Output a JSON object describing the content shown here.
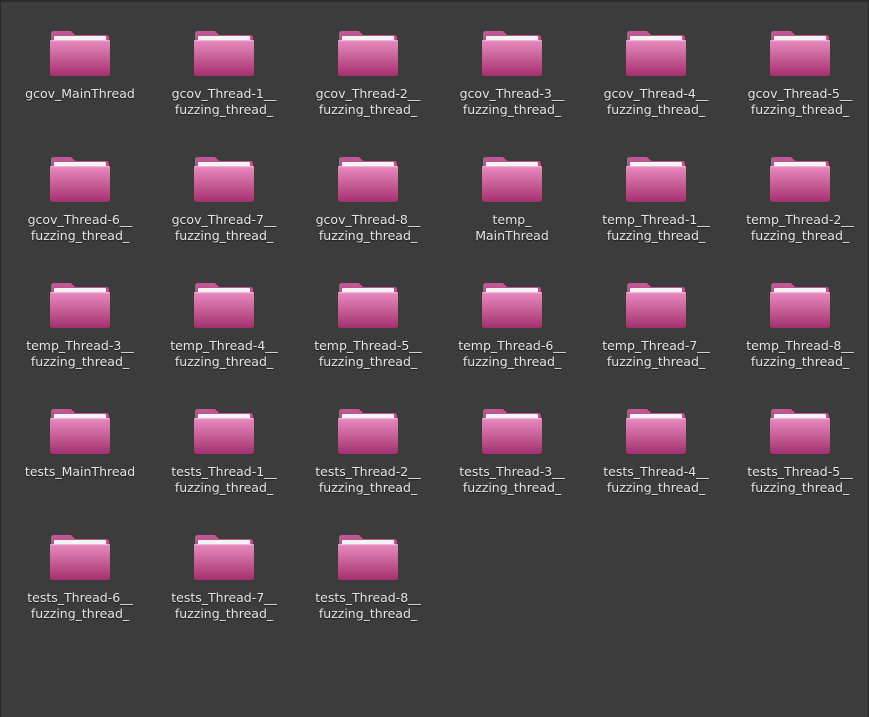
{
  "colors": {
    "background": "#3c3c3c",
    "folder_top": "#e98bc0",
    "folder_bottom": "#a3306e",
    "folder_paper": "#f4f4f4",
    "label_text": "#e6e6e6"
  },
  "icon": "folder-icon",
  "folders": [
    {
      "line1": "gcov_MainThread",
      "line2": ""
    },
    {
      "line1": "gcov_Thread-1__",
      "line2": "fuzzing_thread_"
    },
    {
      "line1": "gcov_Thread-2__",
      "line2": "fuzzing_thread_"
    },
    {
      "line1": "gcov_Thread-3__",
      "line2": "fuzzing_thread_"
    },
    {
      "line1": "gcov_Thread-4__",
      "line2": "fuzzing_thread_"
    },
    {
      "line1": "gcov_Thread-5__",
      "line2": "fuzzing_thread_"
    },
    {
      "line1": "gcov_Thread-6__",
      "line2": "fuzzing_thread_"
    },
    {
      "line1": "gcov_Thread-7__",
      "line2": "fuzzing_thread_"
    },
    {
      "line1": "gcov_Thread-8__",
      "line2": "fuzzing_thread_"
    },
    {
      "line1": "temp_",
      "line2": "MainThread"
    },
    {
      "line1": "temp_Thread-1__",
      "line2": "fuzzing_thread_"
    },
    {
      "line1": "temp_Thread-2__",
      "line2": "fuzzing_thread_"
    },
    {
      "line1": "temp_Thread-3__",
      "line2": "fuzzing_thread_"
    },
    {
      "line1": "temp_Thread-4__",
      "line2": "fuzzing_thread_"
    },
    {
      "line1": "temp_Thread-5__",
      "line2": "fuzzing_thread_"
    },
    {
      "line1": "temp_Thread-6__",
      "line2": "fuzzing_thread_"
    },
    {
      "line1": "temp_Thread-7__",
      "line2": "fuzzing_thread_"
    },
    {
      "line1": "temp_Thread-8__",
      "line2": "fuzzing_thread_"
    },
    {
      "line1": "tests_MainThread",
      "line2": ""
    },
    {
      "line1": "tests_Thread-1__",
      "line2": "fuzzing_thread_"
    },
    {
      "line1": "tests_Thread-2__",
      "line2": "fuzzing_thread_"
    },
    {
      "line1": "tests_Thread-3__",
      "line2": "fuzzing_thread_"
    },
    {
      "line1": "tests_Thread-4__",
      "line2": "fuzzing_thread_"
    },
    {
      "line1": "tests_Thread-5__",
      "line2": "fuzzing_thread_"
    },
    {
      "line1": "tests_Thread-6__",
      "line2": "fuzzing_thread_"
    },
    {
      "line1": "tests_Thread-7__",
      "line2": "fuzzing_thread_"
    },
    {
      "line1": "tests_Thread-8__",
      "line2": "fuzzing_thread_"
    }
  ]
}
